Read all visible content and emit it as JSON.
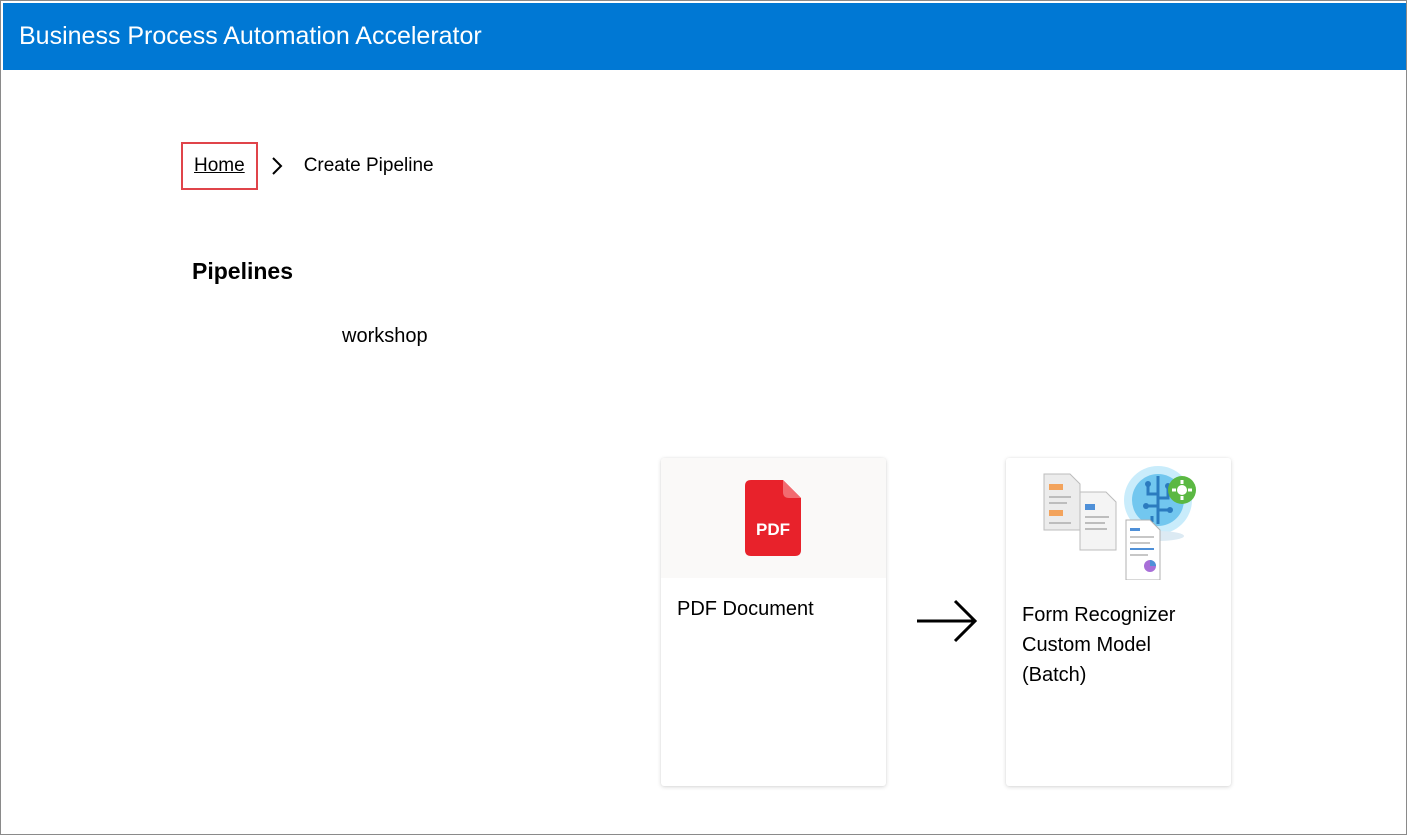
{
  "app": {
    "title": "Business Process Automation Accelerator"
  },
  "breadcrumb": {
    "home": "Home",
    "current": "Create Pipeline"
  },
  "section": {
    "title": "Pipelines"
  },
  "pipeline": {
    "name": "workshop"
  },
  "cards": [
    {
      "label": "PDF Document",
      "icon": "pdf-file-icon",
      "badge": "PDF"
    },
    {
      "label": "Form Recognizer Custom Model (Batch)",
      "icon": "form-recognizer-icon"
    }
  ],
  "colors": {
    "header": "#0078d4",
    "pdf_red": "#e8222b",
    "highlight_border": "#e0444a"
  }
}
